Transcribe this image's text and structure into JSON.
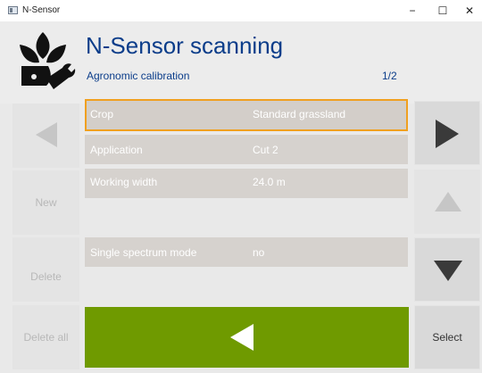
{
  "window": {
    "title": "N-Sensor",
    "minimize": "−",
    "maximize": "☐",
    "close": "✕"
  },
  "header": {
    "title": "N-Sensor scanning",
    "subtitle": "Agronomic calibration",
    "page": "1/2",
    "logo_icon": "plant-wrench-logo-icon"
  },
  "left_buttons": {
    "new": "New",
    "delete": "Delete",
    "delete_all": "Delete all"
  },
  "right_buttons": {
    "select": "Select"
  },
  "settings": [
    {
      "label": "Crop",
      "value": "Standard grassland"
    },
    {
      "label": "Application",
      "value": "Cut 2"
    },
    {
      "label": "Working width",
      "value": "24.0 m"
    },
    {
      "label": "Single spectrum mode",
      "value": "no"
    }
  ],
  "colors": {
    "title_blue": "#0b3d8a",
    "selection_orange": "#f0a020",
    "confirm_green": "#6f9a00"
  }
}
